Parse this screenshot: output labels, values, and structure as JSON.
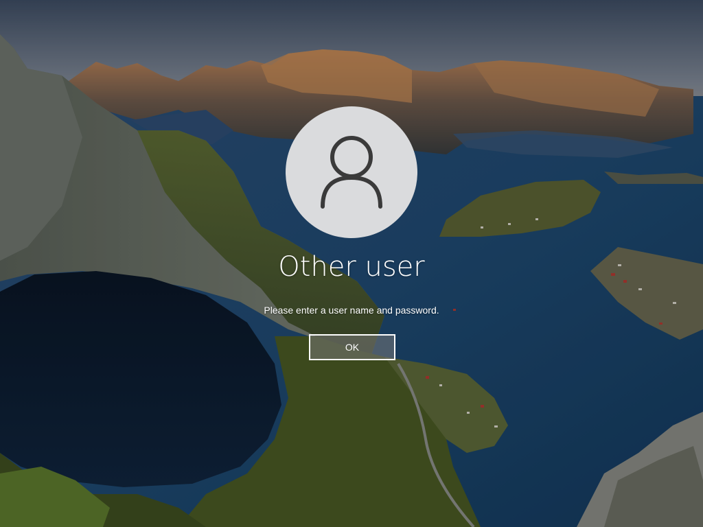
{
  "login": {
    "user_name": "Other user",
    "message": "Please enter a user name and password.",
    "ok_label": "OK"
  },
  "icons": {
    "avatar": "user-silhouette-icon"
  },
  "colors": {
    "text": "#ffffff",
    "avatar_background": "#dadbdd",
    "avatar_glyph": "#3a3a3a",
    "button_border": "#ffffff"
  }
}
